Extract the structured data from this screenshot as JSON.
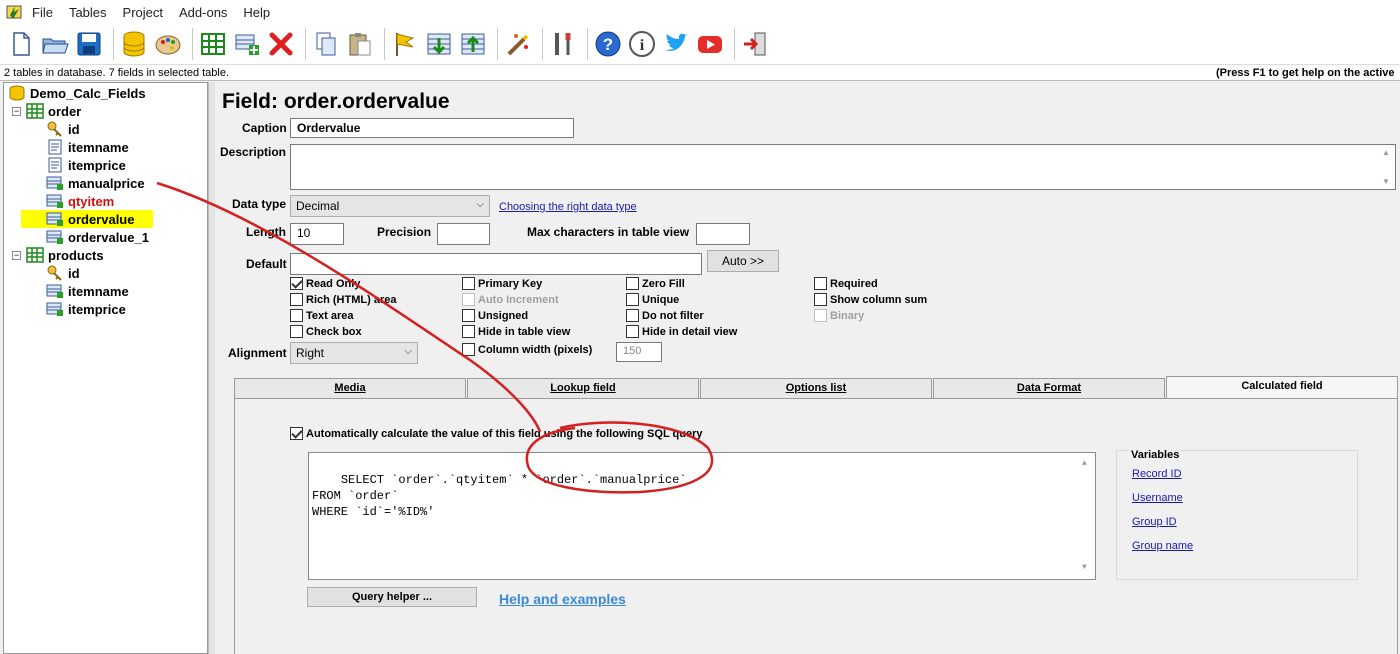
{
  "menu": [
    "File",
    "Tables",
    "Project",
    "Add-ons",
    "Help"
  ],
  "toolbar_icons": [
    "new-file-icon",
    "open-folder-icon",
    "save-icon",
    "database-icon",
    "palette-icon",
    "table-grid-icon",
    "add-field-icon",
    "delete-icon",
    "copy-icon",
    "paste-icon",
    "flag-icon",
    "import-icon",
    "export-icon",
    "magic-wand-icon",
    "tools-icon",
    "help-icon",
    "info-icon",
    "twitter-icon",
    "youtube-icon",
    "exit-icon"
  ],
  "status": {
    "left": "2 tables in database. 7 fields in selected table.",
    "right": "(Press F1 to get help on the active"
  },
  "tree": {
    "database": "Demo_Calc_Fields",
    "tables": [
      {
        "name": "order",
        "fields": [
          {
            "name": "id",
            "kind": "key",
            "color": "#000000"
          },
          {
            "name": "itemname",
            "kind": "text",
            "color": "#000000"
          },
          {
            "name": "itemprice",
            "kind": "text",
            "color": "#000000"
          },
          {
            "name": "manualprice",
            "kind": "calc",
            "color": "#000000"
          },
          {
            "name": "qtyitem",
            "kind": "calc",
            "color": "#d01010"
          },
          {
            "name": "ordervalue",
            "kind": "calc",
            "color": "#000000",
            "selected": true
          },
          {
            "name": "ordervalue_1",
            "kind": "calc",
            "color": "#000000"
          }
        ]
      },
      {
        "name": "products",
        "fields": [
          {
            "name": "id",
            "kind": "key",
            "color": "#000000"
          },
          {
            "name": "itemname",
            "kind": "calc",
            "color": "#000000"
          },
          {
            "name": "itemprice",
            "kind": "calc",
            "color": "#000000"
          }
        ]
      }
    ]
  },
  "main": {
    "title": "Field: order.ordervalue",
    "caption_label": "Caption",
    "caption_value": "Ordervalue",
    "description_label": "Description",
    "description_value": "",
    "datatype_label": "Data type",
    "datatype_value": "Decimal",
    "datatype_link": "Choosing the right data type",
    "length_label": "Length",
    "length_value": "10",
    "precision_label": "Precision",
    "precision_value": "",
    "maxchars_label": "Max characters in table view",
    "maxchars_value": "",
    "default_label": "Default",
    "default_value": "",
    "auto_button": "Auto >>",
    "alignment_label": "Alignment",
    "alignment_value": "Right",
    "column_width_value": "150",
    "checkboxes": {
      "read_only": "Read Only",
      "rich_html": "Rich (HTML) area",
      "text_area": "Text area",
      "check_box": "Check box",
      "primary_key": "Primary Key",
      "auto_increment": "Auto Increment",
      "unsigned": "Unsigned",
      "hide_table_view": "Hide in table view",
      "column_width": "Column width (pixels)",
      "zero_fill": "Zero Fill",
      "unique": "Unique",
      "do_not_filter": "Do not filter",
      "hide_detail_view": "Hide in detail view",
      "required": "Required",
      "show_column_sum": "Show column sum",
      "binary": "Binary"
    },
    "tabs": [
      "Media",
      "Lookup field",
      "Options list",
      "Data Format",
      "Calculated field"
    ],
    "active_tab": "Calculated field",
    "calc": {
      "auto_calc_label": "Automatically calculate the value of this field using the following SQL query",
      "sql": "SELECT `order`.`qtyitem` * `order`.`manualprice`\nFROM `order`\nWHERE `id`='%ID%'",
      "query_helper_button": "Query helper ...",
      "help_link": "Help and examples",
      "variables_title": "Variables",
      "variables": [
        "Record ID",
        "Username",
        "Group ID",
        "Group name"
      ]
    }
  },
  "annotation_color": "#d42020"
}
